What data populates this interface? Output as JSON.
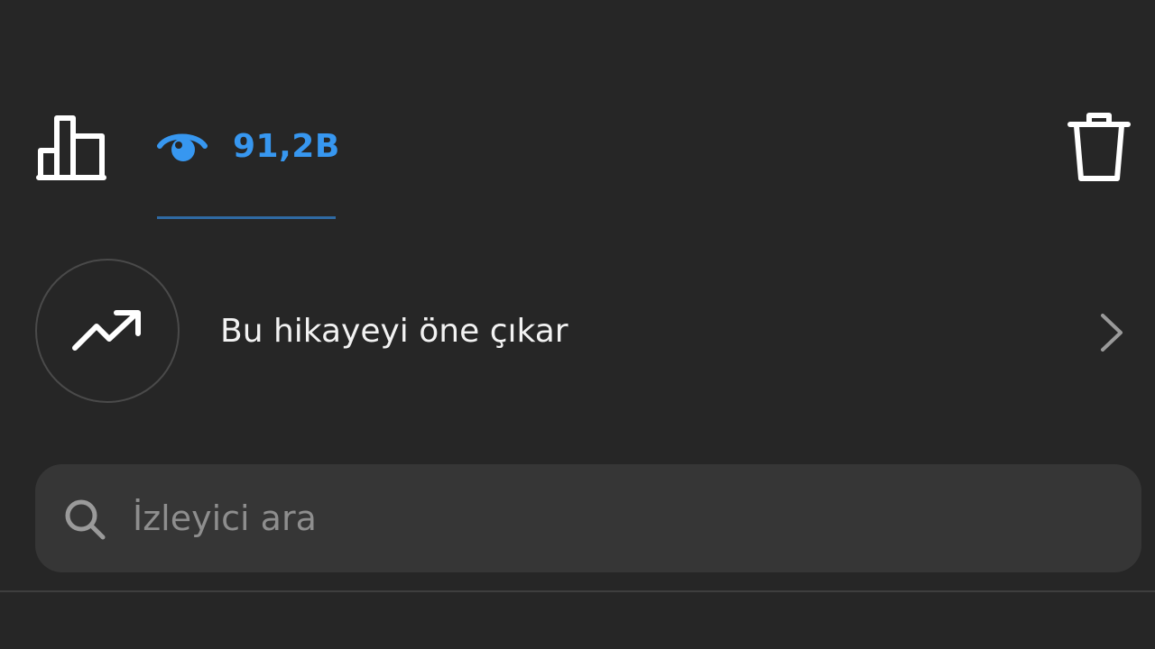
{
  "header": {
    "views_count": "91,2B"
  },
  "icons": {
    "insights": "bar-chart-icon",
    "views": "eye-icon",
    "delete": "trash-icon",
    "promote": "trending-up-icon",
    "chevron": "chevron-right-icon",
    "search": "search-icon"
  },
  "promote": {
    "label": "Bu hikayeyi öne çıkar"
  },
  "search": {
    "placeholder": "İzleyici ara",
    "value": ""
  },
  "colors": {
    "background": "#262626",
    "accent": "#3797f0",
    "search_bg": "#363636",
    "text": "#f2f2f2",
    "placeholder": "#8e8e8e"
  }
}
